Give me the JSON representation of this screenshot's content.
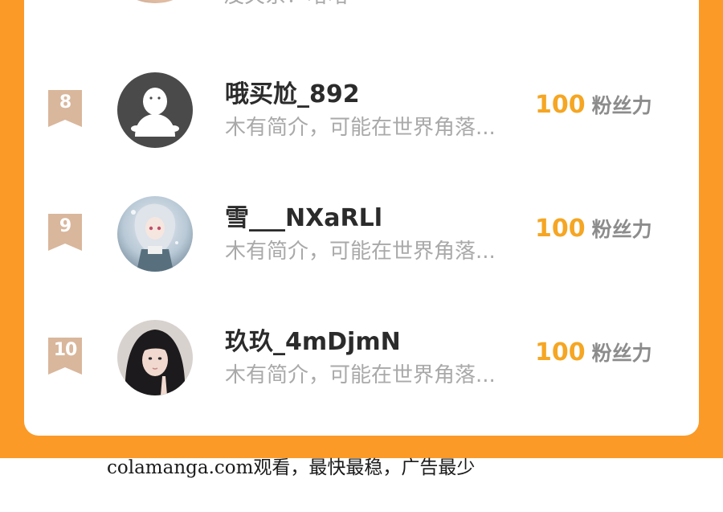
{
  "colors": {
    "frame": "#FB9A27",
    "score": "#F5A623",
    "rank_badge": "#D9B79C",
    "username": "#2b2b2b",
    "secondary_text": "#a9a9a9"
  },
  "partial_top_entry": {
    "bio": "没关系！哈哈"
  },
  "leaderboard": [
    {
      "rank": "8",
      "username": "哦买尬_892",
      "bio": "木有简介，可能在世界角落...",
      "score": "100",
      "score_unit": "粉丝力",
      "avatar": "default-person-icon"
    },
    {
      "rank": "9",
      "username": "雪___NXaRLl",
      "bio": "木有简介，可能在世界角落...",
      "score": "100",
      "score_unit": "粉丝力",
      "avatar": "anime-girl-avatar"
    },
    {
      "rank": "10",
      "username": "玖玖_4mDjmN",
      "bio": "木有简介，可能在世界角落...",
      "score": "100",
      "score_unit": "粉丝力",
      "avatar": "photo-girl-avatar"
    }
  ],
  "footer": {
    "watermark": "colamanga.com观看，最快最稳，广告最少"
  }
}
